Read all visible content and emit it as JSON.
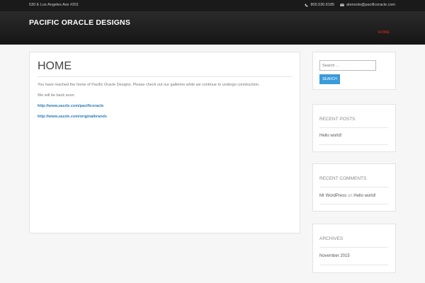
{
  "topbar": {
    "address": "530 E Los Angeles Ave #201",
    "phone": "805.530.6185",
    "email": "atsnoots@pacificoracle.com"
  },
  "header": {
    "site_title": "PACIFIC ORACLE DESIGNS",
    "nav": [
      "HOME"
    ]
  },
  "main": {
    "title": "HOME",
    "paragraphs": [
      "You have reached the home of Pacific Oracle Designs. Please check out our galleries while we continue to undergo construction.",
      "We will be back soon."
    ],
    "links": [
      "http://www.zazzle.com/pacificoracle",
      "http://www.zazzle.com/originalbrandx"
    ]
  },
  "sidebar": {
    "search": {
      "placeholder": "Search ...",
      "button": "SEARCH"
    },
    "recent_posts": {
      "title": "RECENT POSTS",
      "items": [
        "Hello world!"
      ]
    },
    "recent_comments": {
      "title": "RECENT COMMENTS",
      "author": "Mr WordPress",
      "on": "on",
      "post": "Hello world!"
    },
    "archives": {
      "title": "ARCHIVES",
      "items": [
        "November 2015"
      ]
    }
  },
  "colors": {
    "accent": "#e02b20",
    "link": "#2a7ab8",
    "button": "#3a9bd9"
  }
}
